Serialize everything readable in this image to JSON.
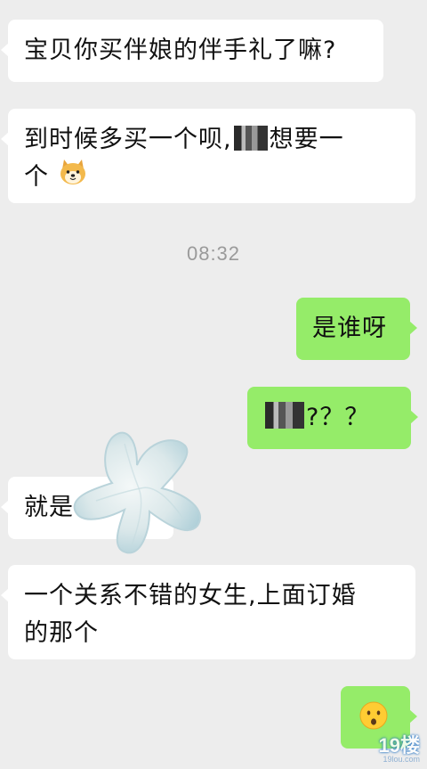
{
  "messages": {
    "m1": "宝贝你买伴娘的伴手礼了嘛?",
    "m2_line1_prefix": "到时候多买一个呗,",
    "m2_line1_suffix": "想要一",
    "m2_line2": "个",
    "time": "08:32",
    "m3": "是谁呀",
    "m4_suffix": "?？？",
    "m5": "就是",
    "m6_line1": "一个关系不错的女生,上面订婚",
    "m6_line2": "的那个"
  },
  "icons": {
    "m2_emoji": "dog-face-icon",
    "m7_emoji": "hushed-face-icon",
    "sticker": "starfish-sticker"
  },
  "watermark": {
    "main": "19楼",
    "sub": "19lou.com"
  },
  "colors": {
    "background": "#ededed",
    "incoming": "#ffffff",
    "outgoing": "#95ec69"
  }
}
